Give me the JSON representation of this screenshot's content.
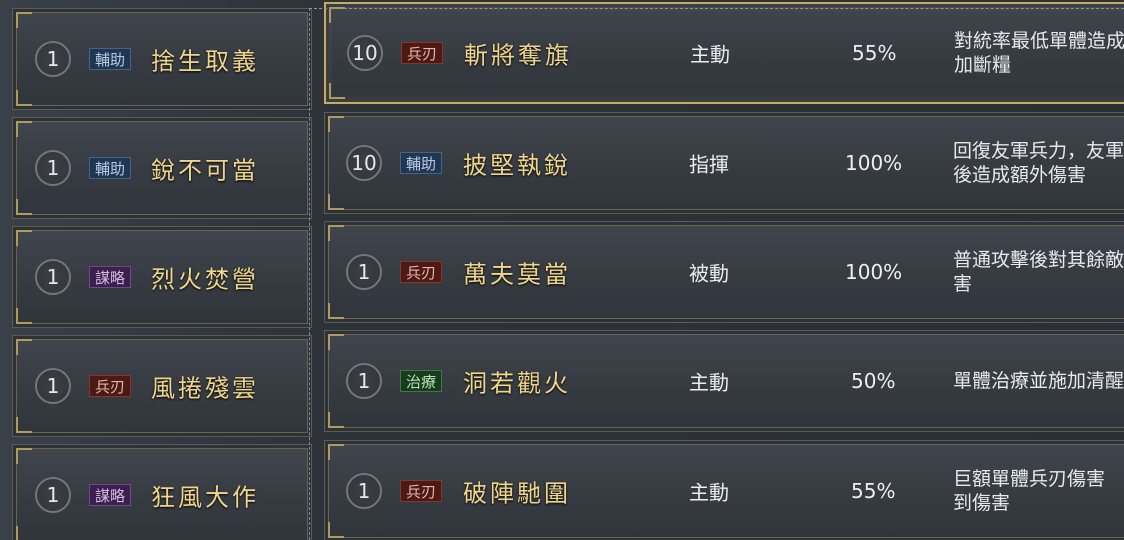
{
  "left_skills": [
    {
      "level": "1",
      "tag": "輔助",
      "tag_color": "blue",
      "name": "捨生取義"
    },
    {
      "level": "1",
      "tag": "輔助",
      "tag_color": "blue",
      "name": "銳不可當"
    },
    {
      "level": "1",
      "tag": "謀略",
      "tag_color": "purple",
      "name": "烈火焚營"
    },
    {
      "level": "1",
      "tag": "兵刃",
      "tag_color": "red",
      "name": "風捲殘雲"
    },
    {
      "level": "1",
      "tag": "謀略",
      "tag_color": "purple",
      "name": "狂風大作"
    }
  ],
  "right_skills": [
    {
      "level": "10",
      "tag": "兵刃",
      "tag_color": "red",
      "name": "斬將奪旗",
      "type": "主動",
      "rate": "55%",
      "desc_line1": "對統率最低單體造成",
      "desc_line2": "加斷糧",
      "selected": true
    },
    {
      "level": "10",
      "tag": "輔助",
      "tag_color": "blue",
      "name": "披堅執銳",
      "type": "指揮",
      "rate": "100%",
      "desc_line1": "回復友軍兵力，友軍",
      "desc_line2": "後造成額外傷害",
      "selected": false
    },
    {
      "level": "1",
      "tag": "兵刃",
      "tag_color": "red",
      "name": "萬夫莫當",
      "type": "被動",
      "rate": "100%",
      "desc_line1": "普通攻擊後對其餘敵",
      "desc_line2": "害",
      "selected": false
    },
    {
      "level": "1",
      "tag": "治療",
      "tag_color": "green",
      "name": "洞若觀火",
      "type": "主動",
      "rate": "50%",
      "desc_line1": "單體治療並施加清醒",
      "desc_line2": "",
      "selected": false
    },
    {
      "level": "1",
      "tag": "兵刃",
      "tag_color": "red",
      "name": "破陣馳圍",
      "type": "主動",
      "rate": "55%",
      "desc_line1": "巨額單體兵刃傷害",
      "desc_line2": "到傷害",
      "selected": false
    }
  ],
  "colors": {
    "gold_name": "#f0d68a",
    "selected_border": "#c8ab62",
    "background": "#2d3238"
  }
}
